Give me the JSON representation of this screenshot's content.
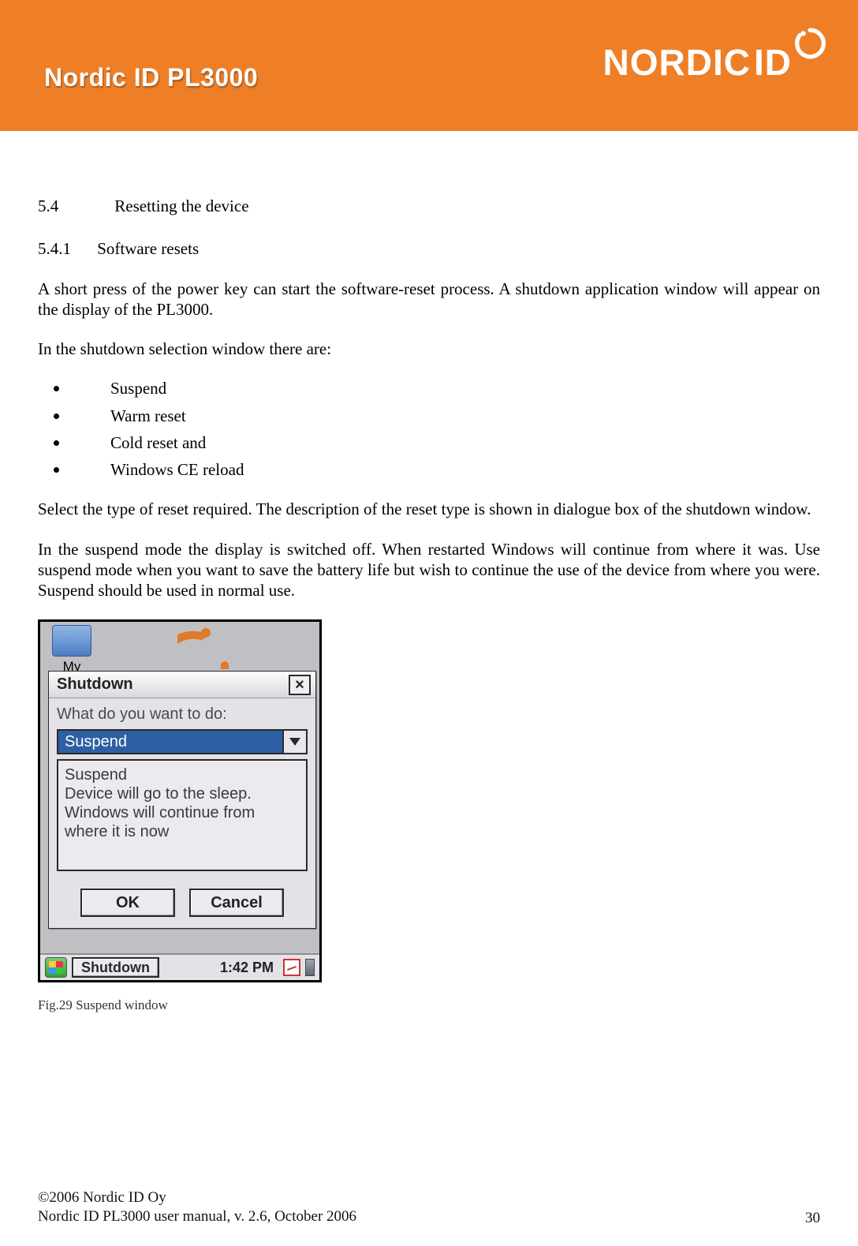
{
  "header": {
    "product": "Nordic ID PL3000",
    "brand": "NORDIC",
    "brand_suffix": "ID"
  },
  "section": {
    "num": "5.4",
    "title": "Resetting the device",
    "sub_num": "5.4.1",
    "sub_title": "Software resets"
  },
  "paras": {
    "p1": "A short press of the power key can start the software-reset process. A shutdown application window will appear on the display of the PL3000.",
    "p2": "In the shutdown selection window there are:",
    "p3": "Select the type of reset required. The description of the reset type is shown in dialogue box of the shutdown window.",
    "p4": "In the suspend mode the display is switched off. When restarted Windows will continue from where it was. Use suspend mode when you want to save the battery life but wish to continue the use of the device from where you were. Suspend should be used in normal use."
  },
  "bullets": [
    "Suspend",
    "Warm reset",
    "Cold reset and",
    "Windows CE reload"
  ],
  "screenshot": {
    "desktop_icon_label": "My",
    "dialog_title": "Shutdown",
    "prompt": "What do you want to do:",
    "selected": "Suspend",
    "description_l1": "Suspend",
    "description_l2": "Device will go to the sleep.",
    "description_l3": "Windows will continue from where it is now",
    "ok": "OK",
    "cancel": "Cancel",
    "task_button": "Shutdown",
    "clock": "1:42 PM"
  },
  "caption": "Fig.29 Suspend window",
  "footer": {
    "copyright": "©2006 Nordic ID Oy",
    "manual": "Nordic ID PL3000 user manual, v. 2.6, October 2006",
    "page": "30"
  }
}
